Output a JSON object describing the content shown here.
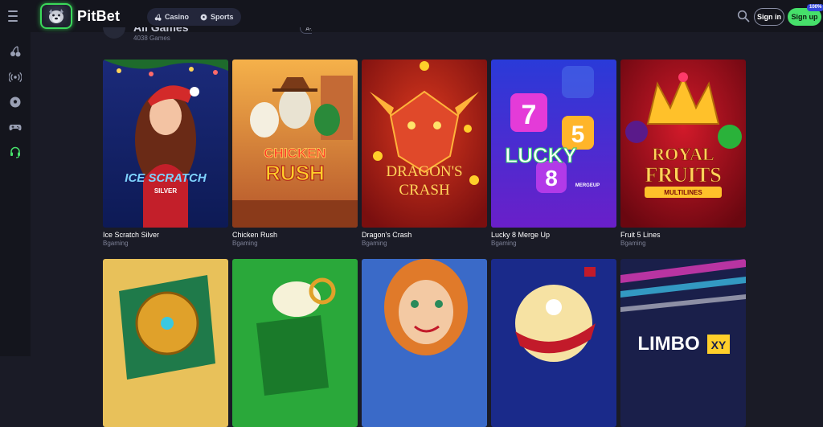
{
  "brand": {
    "name": "PitBet"
  },
  "nav": {
    "casino": "Casino",
    "sports": "Sports"
  },
  "auth": {
    "signin": "Sign in",
    "signup": "Sign up",
    "bonus_badge": "100%"
  },
  "section": {
    "title": "All Games",
    "count": "4038 Games",
    "sort_label": "A-Z"
  },
  "sidebar": {
    "items": [
      "menu-icon",
      "cherries-icon",
      "live-broadcast-icon",
      "soccer-ball-icon",
      "gamepad-icon",
      "support-headset-icon"
    ]
  },
  "games": [
    {
      "name": "Ice Scratch Silver",
      "provider": "Bgaming",
      "art_text": "ICE SCRATCH",
      "art_sub": "SILVER"
    },
    {
      "name": "Chicken Rush",
      "provider": "Bgaming",
      "art_text": "CHICKEN",
      "art_sub": "RUSH"
    },
    {
      "name": "Dragon's Crash",
      "provider": "Bgaming",
      "art_text": "DRAGON'S",
      "art_sub": "CRASH"
    },
    {
      "name": "Lucky 8 Merge Up",
      "provider": "Bgaming",
      "art_text": "LUCKY",
      "art_sub": "MERGEUP"
    },
    {
      "name": "Fruit 5 Lines",
      "provider": "Bgaming",
      "art_text": "ROYAL",
      "art_sub": "FRUITS",
      "art_sub2": "MULTILINES"
    },
    {
      "name": "",
      "provider": ""
    },
    {
      "name": "",
      "provider": ""
    },
    {
      "name": "",
      "provider": ""
    },
    {
      "name": "",
      "provider": ""
    },
    {
      "name": "",
      "provider": "",
      "art_text": "LIMBO",
      "art_sub": "XY"
    }
  ],
  "colors": {
    "accent_green": "#46e06a",
    "background": "#1a1b26",
    "bar": "#14151d"
  }
}
